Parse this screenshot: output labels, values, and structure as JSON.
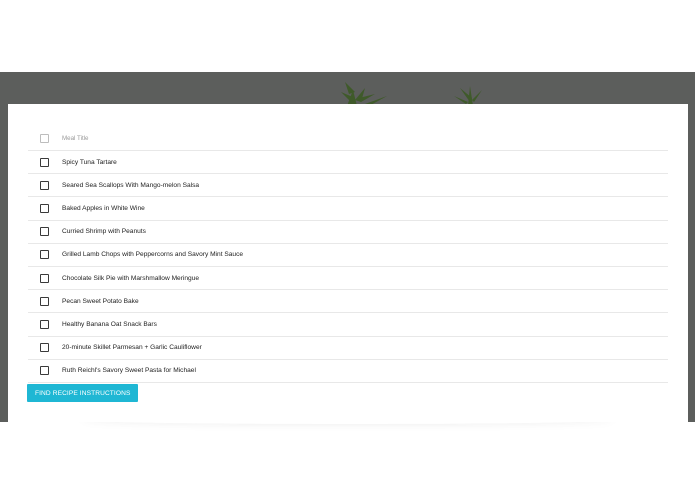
{
  "table": {
    "header_label": "Meal Title",
    "rows": [
      "Spicy Tuna Tartare",
      "Seared Sea Scallops With Mango-melon Salsa",
      "Baked Apples in White Wine",
      "Curried Shrimp with Peanuts",
      "Grilled Lamb Chops with Peppercorns and Savory Mint Sauce",
      "Chocolate Silk Pie with Marshmallow Meringue",
      "Pecan Sweet Potato Bake",
      "Healthy Banana Oat Snack Bars",
      "20-minute Skillet Parmesan + Garlic Cauliflower",
      "Ruth Reichl's Savory Sweet Pasta for Michael"
    ]
  },
  "actions": {
    "find_label": "FIND RECIPE INSTRUCTIONS"
  },
  "colors": {
    "accent": "#1fb7d4",
    "hero_bg": "#5c5e5c"
  }
}
